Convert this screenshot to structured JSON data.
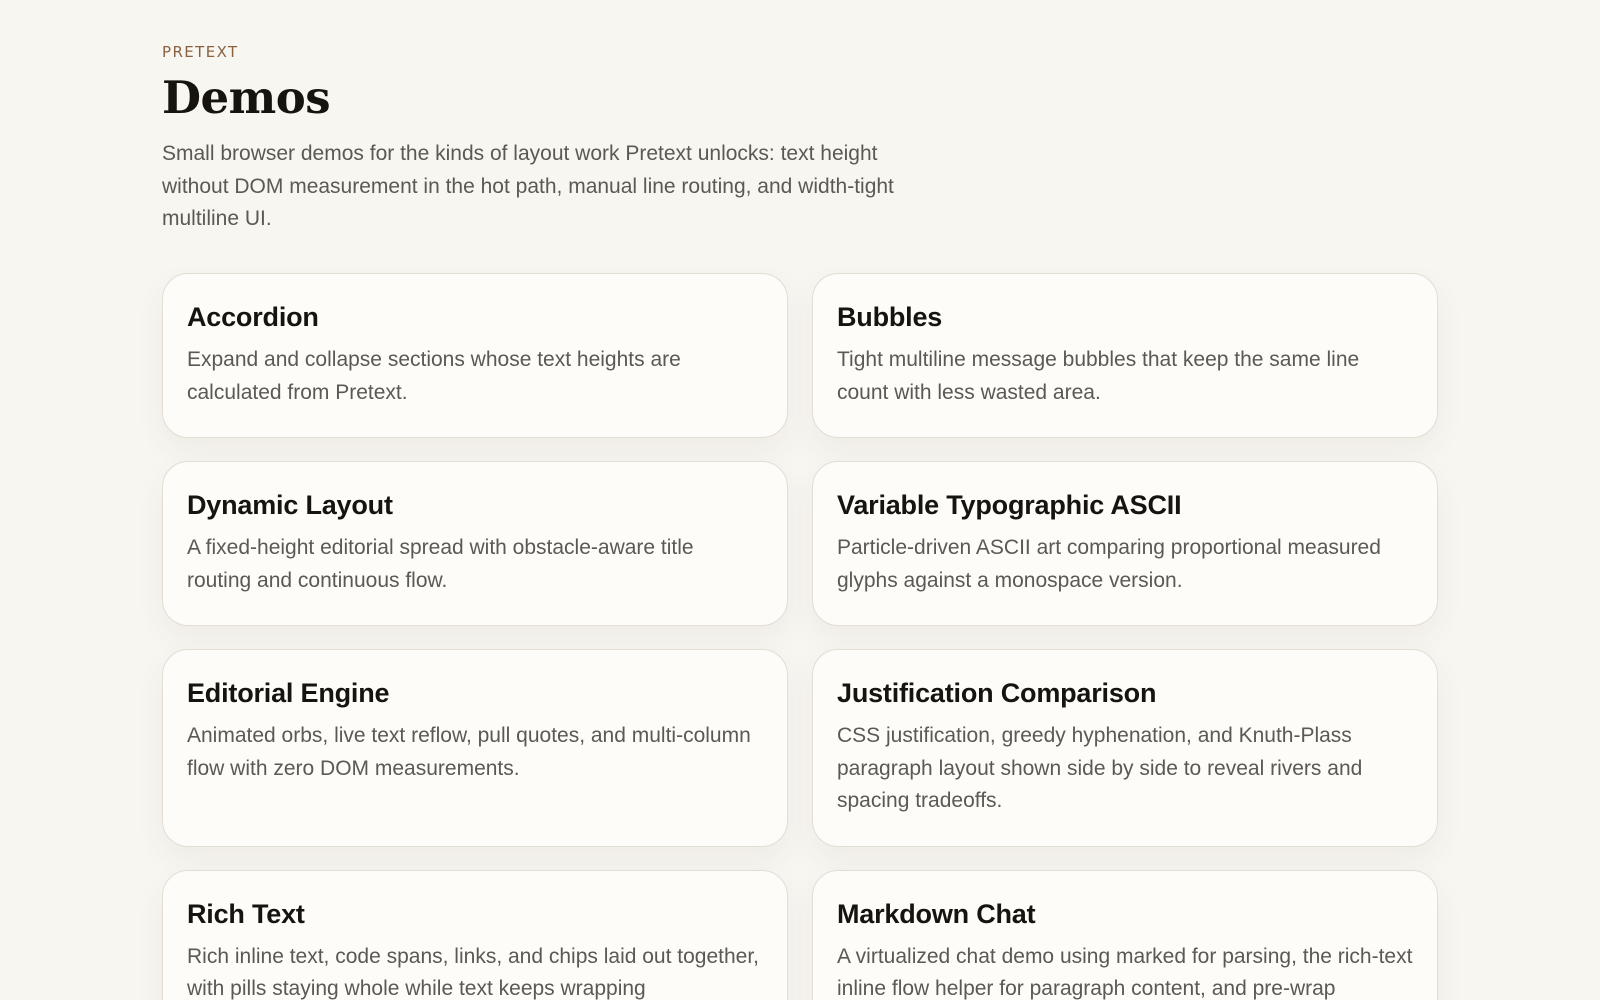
{
  "header": {
    "eyebrow": "PRETEXT",
    "title": "Demos",
    "intro": "Small browser demos for the kinds of layout work Pretext unlocks: text height without DOM measurement in the hot path, manual line routing, and width-tight multiline UI."
  },
  "cards": [
    {
      "title": "Accordion",
      "description": "Expand and collapse sections whose text heights are calculated from Pretext."
    },
    {
      "title": "Bubbles",
      "description": "Tight multiline message bubbles that keep the same line count with less wasted area."
    },
    {
      "title": "Dynamic Layout",
      "description": "A fixed-height editorial spread with obstacle-aware title routing and continuous flow."
    },
    {
      "title": "Variable Typographic ASCII",
      "description": "Particle-driven ASCII art comparing proportional measured glyphs against a monospace version."
    },
    {
      "title": "Editorial Engine",
      "description": "Animated orbs, live text reflow, pull quotes, and multi-column flow with zero DOM measurements."
    },
    {
      "title": "Justification Comparison",
      "description": "CSS justification, greedy hyphenation, and Knuth-Plass paragraph layout shown side by side to reveal rivers and spacing tradeoffs."
    },
    {
      "title": "Rich Text",
      "description": "Rich inline text, code spans, links, and chips laid out together, with pills staying whole while text keeps wrapping"
    },
    {
      "title": "Markdown Chat",
      "description": "A virtualized chat demo using marked for parsing, the rich-text inline flow helper for paragraph content, and pre-wrap"
    }
  ]
}
